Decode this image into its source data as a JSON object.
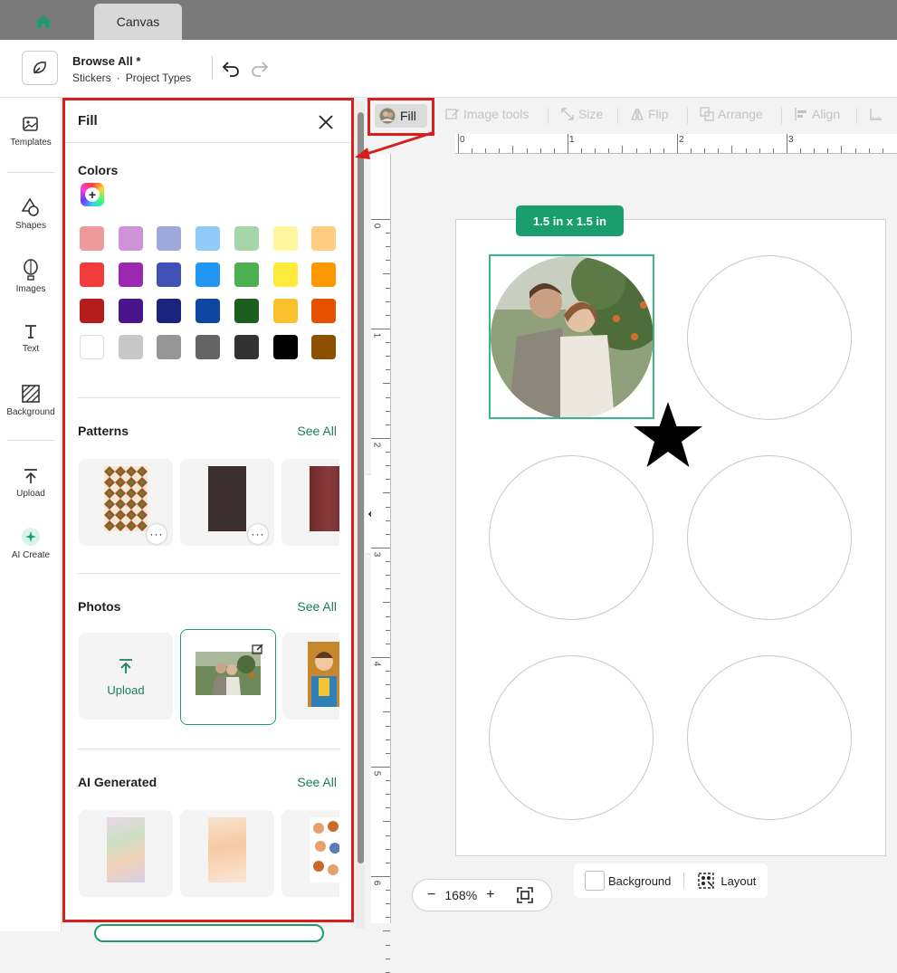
{
  "tabs": {
    "canvas_tab": "Canvas"
  },
  "header": {
    "project_title": "Browse All *",
    "crumb_1": "Stickers",
    "crumb_sep": "·",
    "crumb_2": "Project Types"
  },
  "leftnav": {
    "templates": "Templates",
    "shapes": "Shapes",
    "images": "Images",
    "text": "Text",
    "background": "Background",
    "upload": "Upload",
    "ai_create": "AI Create"
  },
  "panel": {
    "title": "Fill",
    "colors_title": "Colors",
    "patterns_title": "Patterns",
    "photos_title": "Photos",
    "ai_title": "AI Generated",
    "see_all": "See All",
    "upload_label": "Upload",
    "swatches": [
      "#ef9a9a",
      "#ce93d8",
      "#9fa8da",
      "#90caf9",
      "#a5d6a7",
      "#fff59d",
      "#ffcc80",
      "#f23b3b",
      "#9c27b0",
      "#3f51b5",
      "#2196f3",
      "#4caf50",
      "#ffeb3b",
      "#ff9800",
      "#b71c1c",
      "#4a148c",
      "#1a237e",
      "#0d47a1",
      "#1b5e20",
      "#fbc02d",
      "#e65100",
      "#ffffff",
      "#c8c8c8",
      "#969696",
      "#646464",
      "#323232",
      "#000000",
      "#8d5000"
    ]
  },
  "toolbar": {
    "fill": "Fill",
    "image_tools": "Image tools",
    "size": "Size",
    "flip": "Flip",
    "arrange": "Arrange",
    "align": "Align"
  },
  "rulers": {
    "h": [
      "0",
      "1",
      "2",
      "3"
    ],
    "v": [
      "0",
      "1",
      "2",
      "3",
      "4",
      "5",
      "6"
    ]
  },
  "canvas": {
    "size_badge": "1.5  in x 1.5  in"
  },
  "bottom": {
    "zoom": "168%",
    "zoom_minus": "−",
    "zoom_plus": "+",
    "background": "Background",
    "layout": "Layout"
  }
}
